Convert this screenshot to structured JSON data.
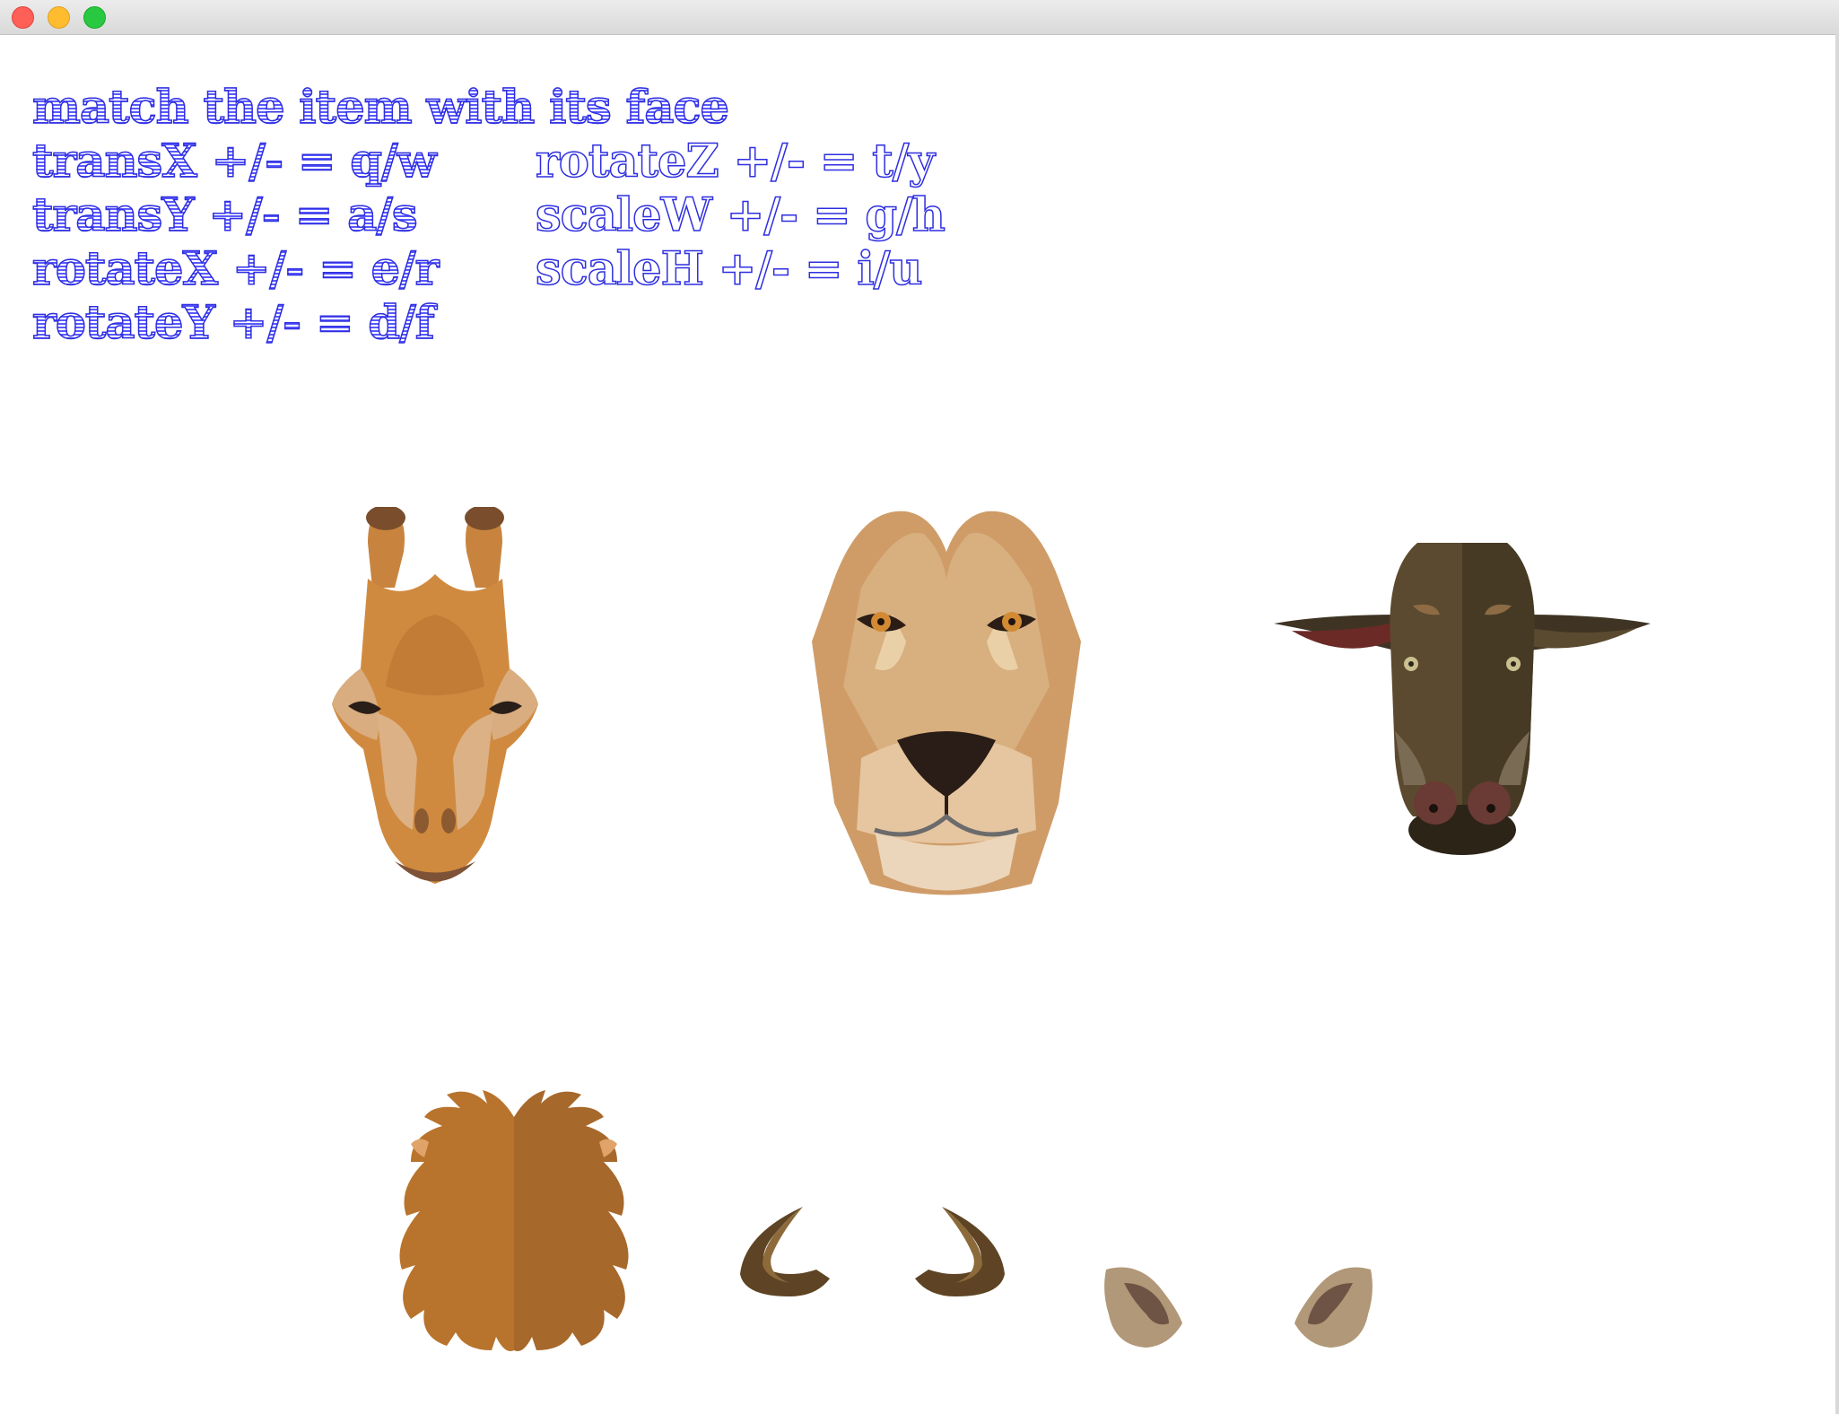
{
  "window": {
    "buttons": [
      "close",
      "minimize",
      "maximize"
    ],
    "colors": {
      "close": "#fe5f57",
      "minimize": "#febc2e",
      "maximize": "#28c840"
    }
  },
  "instructions": {
    "title": "match the item with its face",
    "left_column": [
      "transX +/- = q/w",
      "transY +/- = a/s",
      "rotateX +/- = e/r",
      "rotateY +/- = d/f"
    ],
    "right_column": [
      "rotateZ +/- = t/y",
      "scaleW +/- = g/h",
      "scaleH +/- = i/u"
    ]
  },
  "faces": [
    {
      "name": "giraffe",
      "icon": "giraffe-face-icon"
    },
    {
      "name": "lion",
      "icon": "lioness-face-icon"
    },
    {
      "name": "cow",
      "icon": "bull-face-icon"
    }
  ],
  "items": [
    {
      "name": "mane",
      "icon": "lion-mane-icon"
    },
    {
      "name": "horns",
      "icon": "horns-icon"
    },
    {
      "name": "ears",
      "icon": "ears-icon"
    }
  ]
}
